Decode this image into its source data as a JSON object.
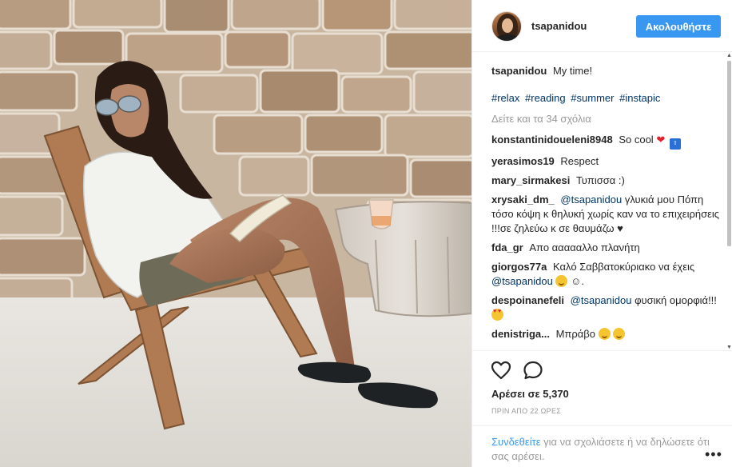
{
  "post": {
    "username": "tsapanidou",
    "follow_label": "Ακολουθήστε",
    "caption": {
      "user": "tsapanidou",
      "text": "My time!"
    },
    "hashtags": [
      "#relax",
      "#reading",
      "#summer",
      "#instapic"
    ],
    "more_comments_label": "Δείτε και τα 34 σχόλια",
    "comments": [
      {
        "user": "konstantinidoueleni8948",
        "text": "So cool"
      },
      {
        "user": "yerasimos19",
        "text": "Respect"
      },
      {
        "user": "mary_sirmakesi",
        "text": "Τυπισσα :)"
      },
      {
        "user": "xrysaki_dm_",
        "mention": "@tsapanidou",
        "text": "γλυκιά μου Πόπη τόσο κόψη κ θηλυκή χωρίς καν να το επιχειρήσεις !!!σε ζηλεύω κ σε θαυμάζω ♥"
      },
      {
        "user": "fda_gr",
        "text": "Απο αααααλλο πλανήτη"
      },
      {
        "user": "giorgos77a",
        "text": "Καλό Σαββατοκύριακο να έχεις",
        "mention": "@tsapanidou",
        "text_after": "☺."
      },
      {
        "user": "despoinanefeli",
        "mention": "@tsapanidou",
        "text": "φυσική ομορφιά!!!"
      },
      {
        "user": "denistriga...",
        "text": "Μπράβο"
      }
    ],
    "likes_label": "Αρέσει σε 5,370",
    "timestamp": "ΠΡΙΝ ΑΠΟ 22 ΩΡΕΣ",
    "login_link": "Συνδεθείτε",
    "login_text": "για να σχολιάσετε ή να δηλώσετε ότι σας αρέσει.",
    "menu_label": "•••"
  },
  "icons": {
    "like": "heart-outline-icon",
    "comment": "speech-bubble-icon",
    "more": "ellipsis-icon"
  },
  "colors": {
    "follow_button": "#3897f0",
    "link": "#3897f0",
    "hashtag": "#003569",
    "secondary_text": "#999999"
  }
}
